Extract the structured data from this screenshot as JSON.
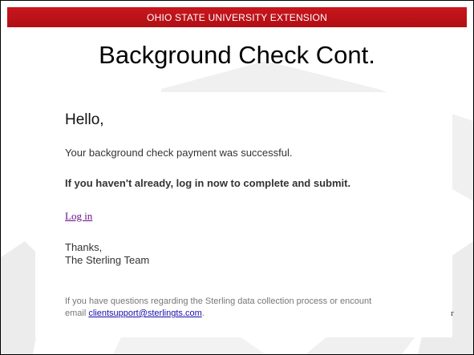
{
  "banner": {
    "text": "OHIO STATE UNIVERSITY EXTENSION"
  },
  "slide": {
    "title": "Background Check Cont."
  },
  "email": {
    "greeting": "Hello,",
    "payment_message": "Your background check payment was successful.",
    "instruction": "If you haven't already, log in now to complete and submit.",
    "login_link": "Log in",
    "thanks": "Thanks,",
    "signature": "The Sterling Team",
    "footer_line1": "If you have questions regarding the Sterling data collection process or encount",
    "footer_line2_prefix": "email ",
    "support_email": "clientsupport@sterlingts.com",
    "footer_line2_suffix": ".",
    "overflow_char": "r"
  },
  "colors": {
    "banner": "#c8161d",
    "link_visited": "#6b0f87",
    "email_link": "#1a0dab"
  }
}
